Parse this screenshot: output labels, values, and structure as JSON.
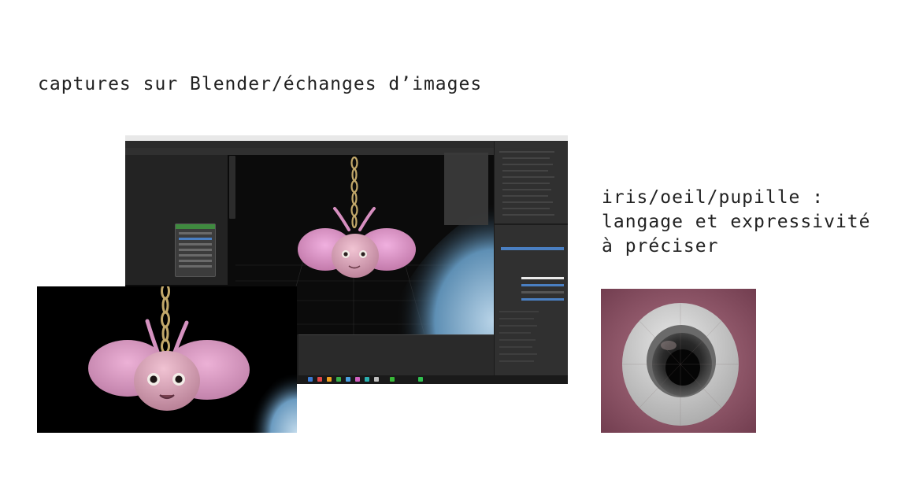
{
  "title": "captures sur Blender/échanges d’images",
  "note": {
    "line1": "iris/oeil/pupille :",
    "line2": "langage et expressivité",
    "line3": "à préciser"
  },
  "images": {
    "blender": "blender-screenshot",
    "render": "render-preview",
    "eye": "eye-closeup"
  },
  "colors": {
    "background": "#ffffff",
    "text": "#222222",
    "character_pink": "#d98fc0",
    "face_pink": "#e0a6bd",
    "chain_gold": "#c2a86a",
    "ground_blue": "#8fb8d8",
    "eye_pink": "#8c5366"
  }
}
